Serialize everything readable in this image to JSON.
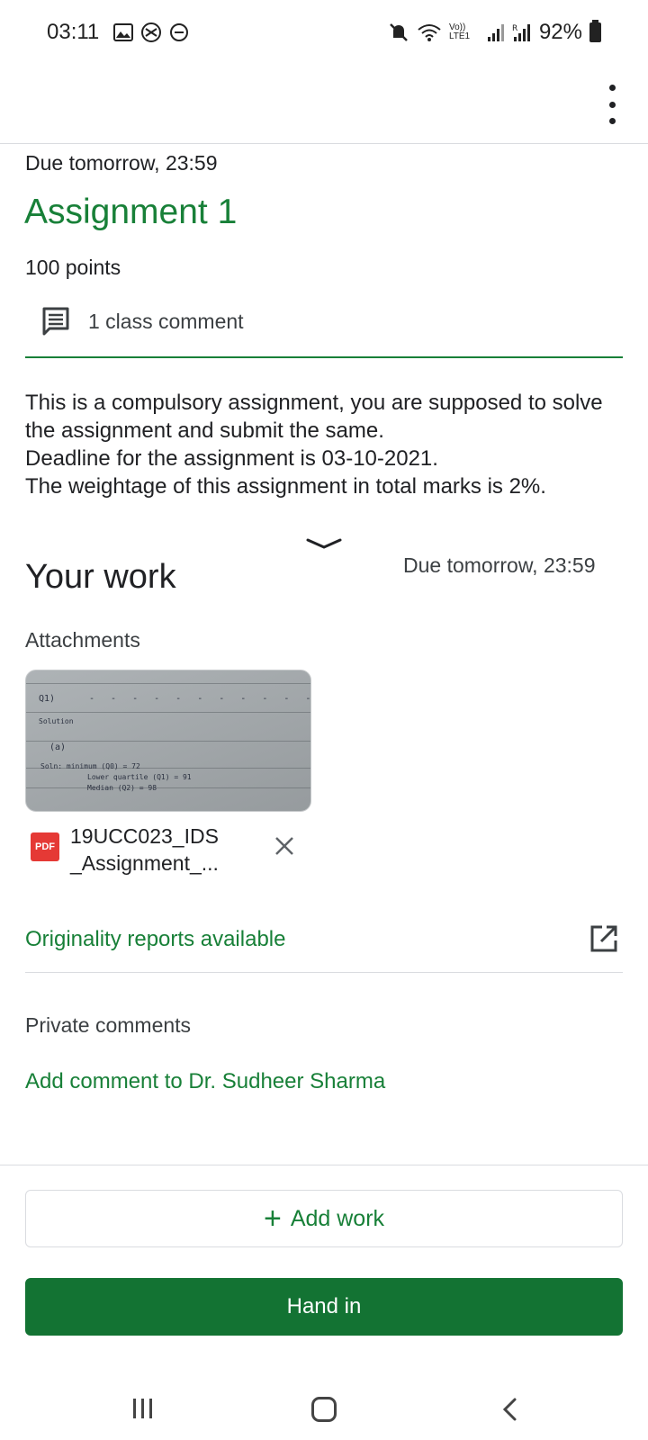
{
  "status_bar": {
    "time": "03:11",
    "left_icons": [
      "gallery-icon",
      "vpn-icon",
      "dnd-icon"
    ],
    "right_icons": [
      "mute-icon",
      "wifi-icon",
      "volte-icon",
      "signal-icon",
      "signal-roaming-icon"
    ],
    "volte_label": "Vo)) LTE1",
    "battery": "92%"
  },
  "top_bar": {
    "more_icon": "more-vert-icon"
  },
  "assignment": {
    "due": "Due tomorrow, 23:59",
    "title": "Assignment 1",
    "points": "100 points",
    "comment_icon": "comment-icon",
    "class_comment": "1 class comment",
    "description": "This is a compulsory assignment, you are supposed to solve the assignment and submit the same.\nDeadline for the assignment is 03-10-2021.\nThe weightage of this assignment in total marks is 2%."
  },
  "your_work": {
    "title": "Your work",
    "due": "Due tomorrow, 23:59",
    "attachments_label": "Attachments",
    "attachment": {
      "file_type": "PDF",
      "file_name": "19UCC023_IDS _Assignment_...",
      "thumbnail_lines": [
        "Q1)",
        "Solution",
        "(a)",
        "Soln:   minimum (Q0) = 72",
        "Lower quartile (Q1) = 91",
        "Median (Q2) = 98"
      ],
      "remove_icon": "close-icon"
    },
    "originality": "Originality reports available",
    "open_icon": "open-in-new-icon",
    "private_comments_label": "Private comments",
    "add_comment": "Add comment to Dr. Sudheer Sharma",
    "add_work_label": "Add work",
    "hand_in_label": "Hand in"
  },
  "nav_bar": {
    "icons": [
      "recent-apps-icon",
      "home-icon",
      "back-icon"
    ]
  },
  "colors": {
    "accent_green": "#188038",
    "button_green": "#137333",
    "pdf_red": "#e53935"
  }
}
